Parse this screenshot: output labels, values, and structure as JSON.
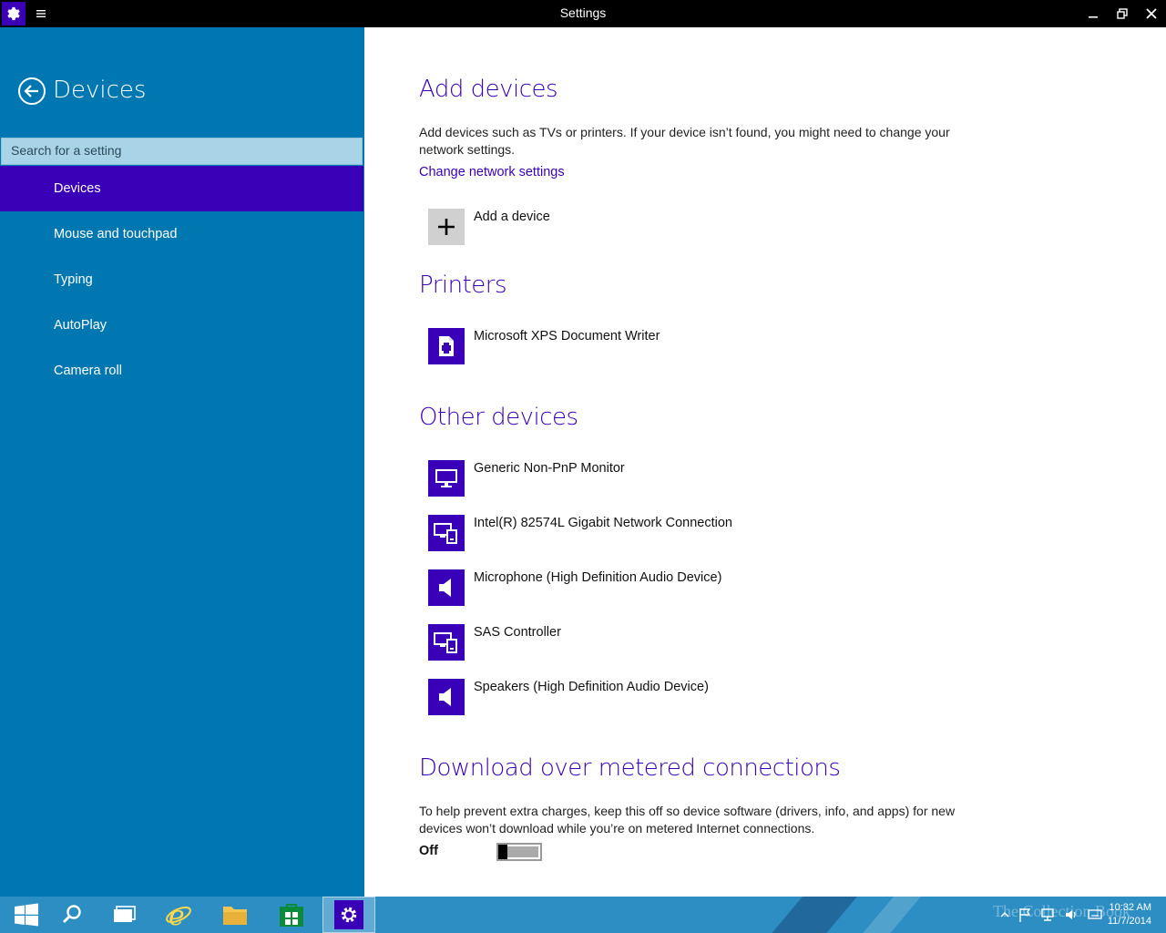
{
  "window": {
    "title": "Settings"
  },
  "sidebar": {
    "title": "Devices",
    "search_placeholder": "Search for a setting",
    "items": [
      {
        "label": "Devices",
        "active": true
      },
      {
        "label": "Mouse and touchpad"
      },
      {
        "label": "Typing"
      },
      {
        "label": "AutoPlay"
      },
      {
        "label": "Camera roll"
      }
    ]
  },
  "add_devices": {
    "heading": "Add devices",
    "description": "Add devices such as TVs or printers. If your device isn’t found, you might need to change your network settings.",
    "link": "Change network settings",
    "add_label": "Add a device"
  },
  "printers": {
    "heading": "Printers",
    "items": [
      {
        "label": "Microsoft XPS Document Writer",
        "icon": "printer-icon"
      }
    ]
  },
  "other_devices": {
    "heading": "Other devices",
    "items": [
      {
        "label": "Generic Non-PnP Monitor",
        "icon": "monitor-icon"
      },
      {
        "label": "Intel(R) 82574L Gigabit Network Connection",
        "icon": "devices-icon"
      },
      {
        "label": "Microphone (High Definition Audio Device)",
        "icon": "speaker-icon"
      },
      {
        "label": "SAS Controller",
        "icon": "devices-icon"
      },
      {
        "label": "Speakers (High Definition Audio Device)",
        "icon": "speaker-icon"
      }
    ]
  },
  "metered": {
    "heading": "Download over metered connections",
    "description": "To help prevent extra charges, keep this off so device software (drivers, info, and apps) for new devices won’t download while you’re on metered Internet connections.",
    "toggle_label": "Off",
    "toggle_on": false
  },
  "taskbar": {
    "time": "10:32 AM",
    "date": "11/7/2014",
    "watermark": "The Collection Book"
  },
  "colors": {
    "accent": "#3a00b8",
    "sidebar": "#0077b1",
    "taskbar": "#2d8ec4"
  }
}
